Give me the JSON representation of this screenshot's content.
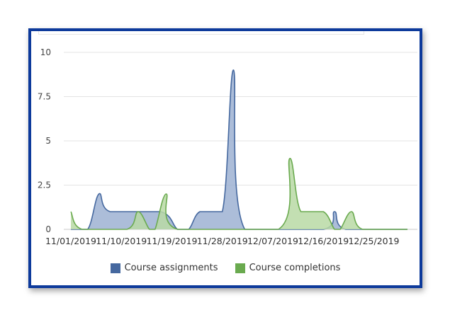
{
  "chart_data": {
    "type": "area",
    "x": [
      "11/01/2019",
      "11/10/2019",
      "11/19/2019",
      "11/28/2019",
      "12/07/2019",
      "12/16/2019",
      "12/25/2019"
    ],
    "ylim": [
      0,
      10
    ],
    "yticks": [
      0,
      2.5,
      5,
      7.5,
      10
    ],
    "ytick_labels": [
      "0",
      "2.5",
      "5",
      "7.5",
      "10"
    ],
    "xlabel": "",
    "ylabel": "",
    "title": "",
    "grid": true,
    "legend_position": "bottom",
    "series": [
      {
        "name": "Course assignments",
        "color": "#45689f",
        "fill": "#9eb2d2",
        "points": [
          {
            "x": "11/01/2019",
            "y": 0
          },
          {
            "x": "11/04/2019",
            "y": 0
          },
          {
            "x": "11/06/2019",
            "y": 2
          },
          {
            "x": "11/08/2019",
            "y": 1
          },
          {
            "x": "11/17/2019",
            "y": 1
          },
          {
            "x": "11/20/2019",
            "y": 0
          },
          {
            "x": "11/22/2019",
            "y": 0
          },
          {
            "x": "11/24/2019",
            "y": 1
          },
          {
            "x": "11/28/2019",
            "y": 1
          },
          {
            "x": "11/30/2019",
            "y": 9
          },
          {
            "x": "12/02/2019",
            "y": 0
          },
          {
            "x": "12/16/2019",
            "y": 0
          },
          {
            "x": "12/18/2019",
            "y": 1
          },
          {
            "x": "12/20/2019",
            "y": 0
          },
          {
            "x": "12/31/2019",
            "y": 0
          }
        ]
      },
      {
        "name": "Course completions",
        "color": "#6aaa4f",
        "fill": "#b9d9a5",
        "points": [
          {
            "x": "11/01/2019",
            "y": 1
          },
          {
            "x": "11/03/2019",
            "y": 0
          },
          {
            "x": "11/11/2019",
            "y": 0
          },
          {
            "x": "11/13/2019",
            "y": 1
          },
          {
            "x": "11/15/2019",
            "y": 0
          },
          {
            "x": "11/16/2019",
            "y": 0
          },
          {
            "x": "11/18/2019",
            "y": 2
          },
          {
            "x": "11/20/2019",
            "y": 0
          },
          {
            "x": "12/08/2019",
            "y": 0
          },
          {
            "x": "12/10/2019",
            "y": 4
          },
          {
            "x": "12/12/2019",
            "y": 1
          },
          {
            "x": "12/16/2019",
            "y": 1
          },
          {
            "x": "12/18/2019",
            "y": 0
          },
          {
            "x": "12/19/2019",
            "y": 0
          },
          {
            "x": "12/21/2019",
            "y": 1
          },
          {
            "x": "12/23/2019",
            "y": 0
          },
          {
            "x": "12/31/2019",
            "y": 0
          }
        ]
      }
    ]
  },
  "legend": {
    "items": [
      {
        "label": "Course assignments",
        "color": "#45689f"
      },
      {
        "label": "Course completions",
        "color": "#6aaa4f"
      }
    ]
  }
}
